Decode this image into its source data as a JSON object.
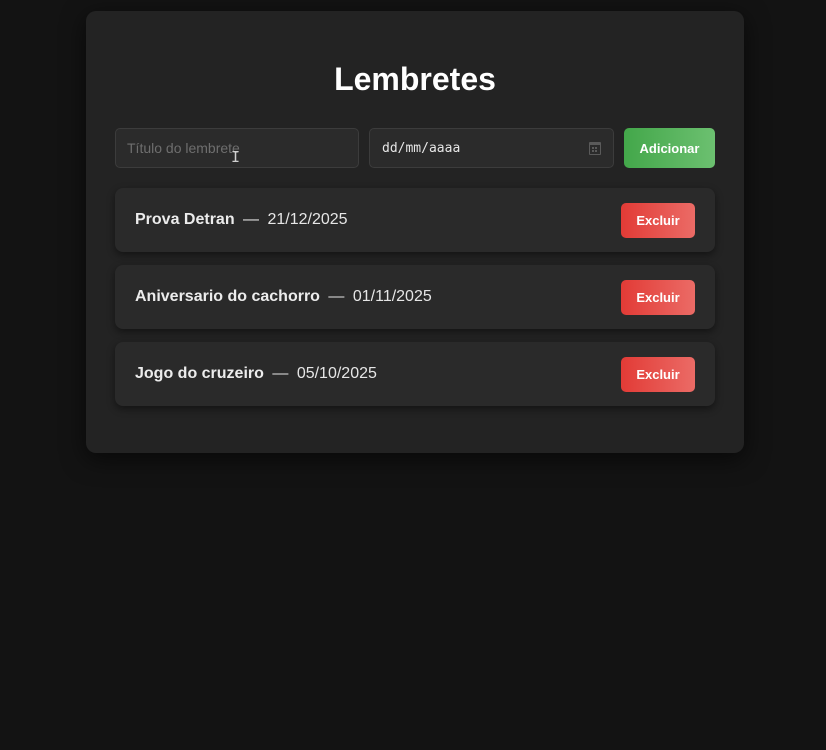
{
  "app": {
    "title": "Lembretes"
  },
  "form": {
    "title_input": {
      "placeholder": "Título do lembrete",
      "value": ""
    },
    "date_input": {
      "display": "dd/mm/aaaa"
    },
    "add_label": "Adicionar"
  },
  "reminders": [
    {
      "title": "Prova Detran",
      "separator": "—",
      "date": "21/12/2025",
      "delete_label": "Excluir"
    },
    {
      "title": "Aniversario do cachorro",
      "separator": "—",
      "date": "01/11/2025",
      "delete_label": "Excluir"
    },
    {
      "title": "Jogo do cruzeiro",
      "separator": "—",
      "date": "05/10/2025",
      "delete_label": "Excluir"
    }
  ],
  "colors": {
    "background": "#131313",
    "card": "#232323",
    "add_button": "#4caf50",
    "delete_button": "#e53935"
  },
  "icons": {
    "date_picker": "calendar-icon",
    "mouse_cursor": "text-cursor-icon"
  }
}
